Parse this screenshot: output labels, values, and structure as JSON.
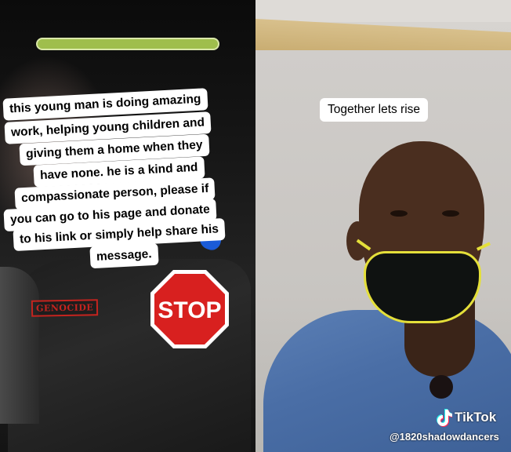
{
  "left_panel": {
    "caption_lines": [
      "this young man is doing amazing",
      "work, helping young children and",
      "giving them a home when they",
      "have none. he is a kind and",
      "compassionate person, please if",
      "you can go to his page and donate",
      "to his link or simply help share his",
      "message."
    ],
    "stamp_text": "GENOCIDE",
    "stop_sign_text": "STOP"
  },
  "right_panel": {
    "caption": "Together lets rise"
  },
  "watermark": {
    "brand": "TikTok",
    "handle": "@1820shadowdancers"
  },
  "colors": {
    "progress_bar": "#9fbe4c",
    "stop_red": "#d8201f",
    "mask_strap": "#e4df3a",
    "stamp_red": "#c5241f"
  }
}
